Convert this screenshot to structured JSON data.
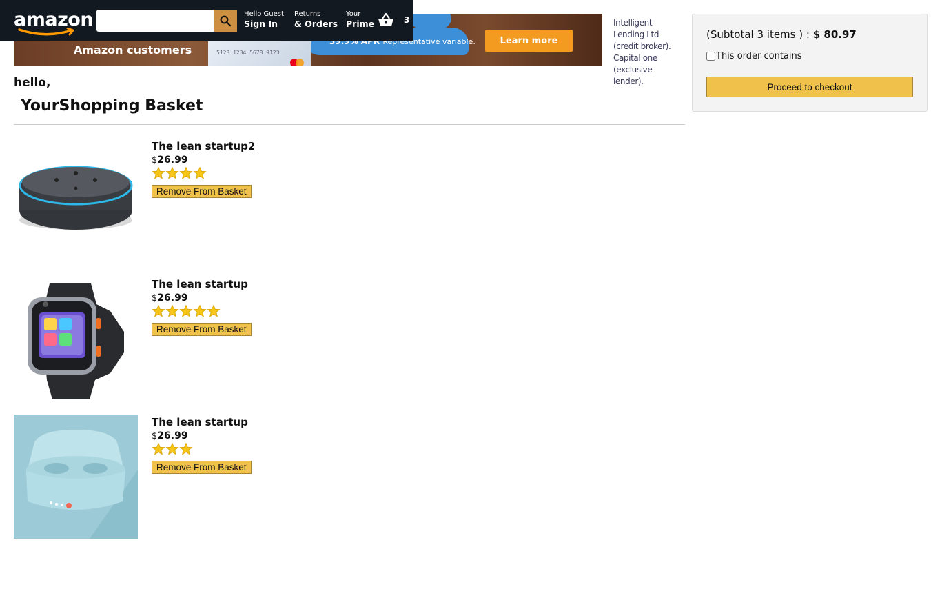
{
  "header": {
    "logo_text": "amazon",
    "search": {
      "value": "",
      "placeholder": ""
    },
    "nav": [
      {
        "line1": "Hello Guest",
        "line2": "Sign In"
      },
      {
        "line1": "Returns",
        "line2": "& Orders"
      },
      {
        "line1": "Your",
        "line2": "Prime"
      }
    ],
    "basket_count": "3",
    "icons": {
      "search": "search-icon",
      "basket": "basket-icon"
    }
  },
  "banner": {
    "headline": "Amazon customers",
    "card_number": "5123 1234 5678 9123",
    "apr_value": "39.9% APR",
    "apr_text": "Representative variable.",
    "cta": "Learn more",
    "side_text": "Intelligent Lending Ltd (credit broker). Capital one (exclusive lender)."
  },
  "greeting": "hello,",
  "title": "YourShopping Basket",
  "products": [
    {
      "title": "The lean startup2",
      "currency": "$",
      "price": "26.99",
      "rating": 4,
      "remove_label": "Remove From Basket",
      "image": "echo-dot-speaker"
    },
    {
      "title": "The lean startup",
      "currency": "$",
      "price": "26.99",
      "rating": 5,
      "remove_label": "Remove From Basket",
      "image": "kids-smartwatch"
    },
    {
      "title": "The lean startup",
      "currency": "$",
      "price": "26.99",
      "rating": 3,
      "remove_label": "Remove From Basket",
      "image": "wireless-earbuds"
    }
  ],
  "subtotal": {
    "label": "(Subtotal 3 items ) :",
    "amount": "$ 80.97",
    "gift_label": "This order contains",
    "checkout_label": "Proceed to checkout"
  },
  "colors": {
    "header_bg": "#131921",
    "button_yellow": "#f0c14b",
    "search_btn": "#cd9042",
    "star": "#f5c518",
    "learn_more": "#f39a21"
  }
}
